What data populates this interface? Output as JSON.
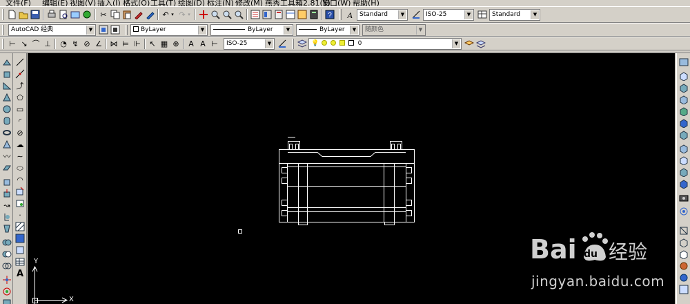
{
  "menu": [
    "文件(F)",
    "编辑(E)",
    "视图(V)",
    "插入(I)",
    "格式(O)",
    "工具(T)",
    "绘图(D)",
    "标注(N)",
    "修改(M)",
    "燕秀工具箱2.81(Y)",
    "窗口(W)",
    "帮助(H)"
  ],
  "toolbar_styles": {
    "text_style": "Standard",
    "dim_style": "ISO-25",
    "table_style": "Standard"
  },
  "workspace": "AutoCAD 经典",
  "properties": {
    "layer_color": "ByLayer",
    "linetype": "ByLayer",
    "lineweight": "ByLayer",
    "plot_style": "随颜色"
  },
  "dimension_toolbar": {
    "dim_style": "ISO-25"
  },
  "layer_toolbar": {
    "current_layer": "0"
  },
  "ucs": {
    "y_label": "Y",
    "x_label": "X"
  },
  "watermark": {
    "logo_text": "Bai  经验",
    "url": "jingyan.baidu.com"
  },
  "colors": {
    "canvas": "#000000",
    "ui_face": "#d4d0c8",
    "drawing_line": "#ffffff",
    "watermark": "#d0d0d0"
  },
  "icons": {
    "toolbar1": [
      "new-icon",
      "open-icon",
      "save-icon",
      "print-icon",
      "plot-preview-icon",
      "publish-icon",
      "3d-dwf-icon",
      "cut-icon",
      "copy-icon",
      "paste-icon",
      "match-properties-icon",
      "block-editor-icon",
      "undo-icon",
      "redo-icon",
      "pan-icon",
      "zoom-realtime-icon",
      "zoom-window-icon",
      "zoom-previous-icon",
      "properties-icon",
      "design-center-icon",
      "tool-palettes-icon",
      "sheet-set-icon",
      "markup-icon",
      "quickcalc-icon",
      "help-icon",
      "text-style-icon",
      "dim-style-icon",
      "table-style-icon"
    ],
    "draw_left": [
      "line-icon",
      "construction-line-icon",
      "polyline-icon",
      "polygon-icon",
      "rectangle-icon",
      "arc-icon",
      "circle-icon",
      "revision-cloud-icon",
      "spline-icon",
      "ellipse-icon",
      "ellipse-arc-icon",
      "insert-block-icon",
      "make-block-icon",
      "point-icon",
      "hatch-icon",
      "gradient-icon",
      "region-icon",
      "table-icon",
      "mtext-icon"
    ]
  }
}
